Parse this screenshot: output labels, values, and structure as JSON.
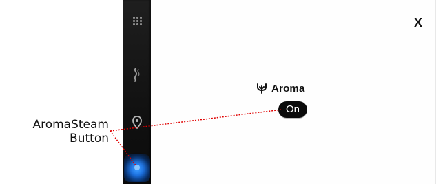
{
  "dialog": {
    "close_label": "X",
    "title": "Aroma",
    "toggle_label": "On"
  },
  "annotation": {
    "line_1": "AromaSteam",
    "line_2": "Button"
  },
  "icons": {
    "sidebar_grid": "grid-icon",
    "sidebar_steam": "steam-icon",
    "sidebar_pin": "pin-icon",
    "aroma": "aroma-icon",
    "close": "close-icon"
  },
  "colors": {
    "sidebar": "#111111",
    "panel": "#fefefe",
    "highlight": "#1567d6",
    "toggle": "#0b0b0b",
    "annotation_line": "#e00000"
  }
}
